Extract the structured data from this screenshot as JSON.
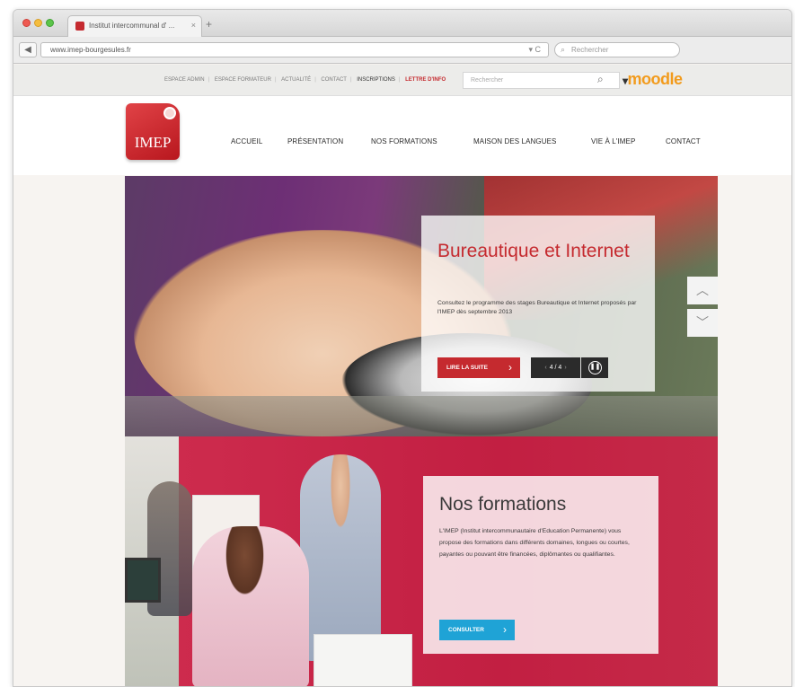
{
  "browser": {
    "tab_title": "Institut intercommunal d' ...",
    "tab_close": "×",
    "new_tab": "+",
    "back": "◀",
    "url": "www.imep-bourgesules.fr",
    "reload": "▾ C",
    "search_placeholder": "Rechercher"
  },
  "utility": {
    "links": [
      "ESPACE ADMIN",
      "ESPACE FORMATEUR",
      "ACTUALITÉ",
      "CONTACT",
      "INSCRIPTIONS",
      "LETTRE D'INFO"
    ],
    "site_search_placeholder": "Rechercher",
    "moodle": "moodle"
  },
  "header": {
    "logo_text": "IMEP",
    "nav": [
      "ACCUEIL",
      "PRÉSENTATION",
      "NOS FORMATIONS",
      "MAISON DES LANGUES",
      "VIE À L'IMEP",
      "CONTACT"
    ]
  },
  "slide": {
    "title": "Bureautique et Internet",
    "description": "Consultez le programme des stages Bureautique et Internet proposés par l'IMEP dès septembre 2013",
    "button": "LIRE LA SUITE",
    "pager": "4 / 4",
    "arrow_up": "︿",
    "arrow_down": "﹀"
  },
  "formations": {
    "title": "Nos formations",
    "description": "L'IMEP (Institut intercommunautaire d'Education Permanente) vous propose des formations dans différents domaines, longues ou courtes, payantes ou pouvant être financées, diplômantes ou qualifiantes.",
    "button": "CONSULTER"
  },
  "colors": {
    "brand_red": "#c52a2f",
    "accent_blue": "#1fa3d6",
    "moodle_orange": "#f29b1d"
  }
}
